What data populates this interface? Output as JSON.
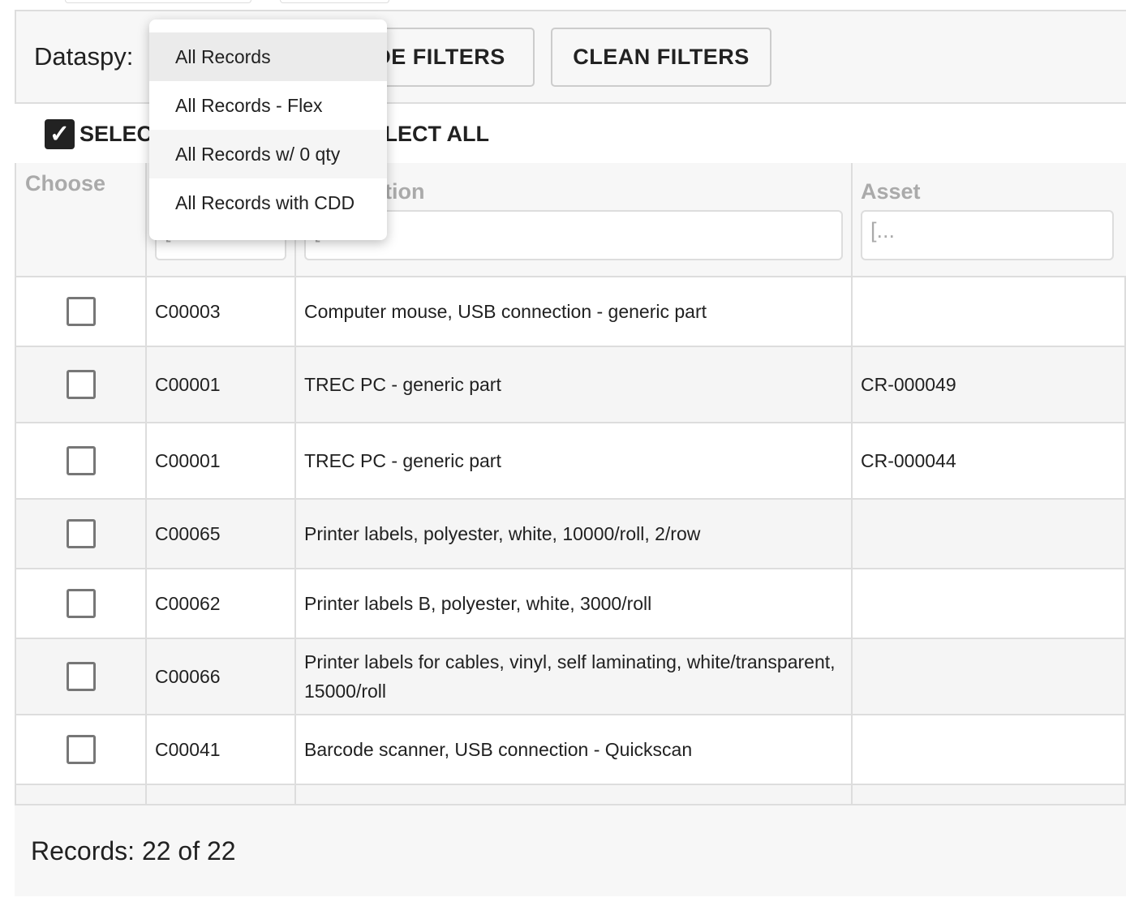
{
  "toolbar": {
    "dataspy_label": "Dataspy:",
    "hide_filters": "HIDE FILTERS",
    "clean_filters": "CLEAN FILTERS"
  },
  "selection": {
    "select_all": "SELECT ALL",
    "deselect_all": "DESELECT ALL",
    "select_all_checked": true
  },
  "table": {
    "headers": {
      "choose": "Choose",
      "description": "Description",
      "asset": "Asset"
    },
    "filter_placeholder": "[...",
    "rows": [
      {
        "code": "C00003",
        "description": "Computer mouse, USB connection - generic part",
        "asset": ""
      },
      {
        "code": "C00001",
        "description": "TREC PC - generic part",
        "asset": "CR-000049"
      },
      {
        "code": "C00001",
        "description": "TREC PC - generic part",
        "asset": "CR-000044"
      },
      {
        "code": "C00065",
        "description": "Printer labels, polyester, white, 10000/roll, 2/row",
        "asset": ""
      },
      {
        "code": "C00062",
        "description": "Printer labels B, polyester, white, 3000/roll",
        "asset": ""
      },
      {
        "code": "C00066",
        "description": "Printer labels for cables, vinyl, self laminating, white/transparent, 15000/roll",
        "asset": ""
      },
      {
        "code": "C00041",
        "description": "Barcode scanner, USB connection - Quickscan",
        "asset": ""
      }
    ]
  },
  "footer": {
    "records": "Records: 22 of 22"
  },
  "dataspy_dropdown": {
    "selected": "All Records",
    "options": [
      "All Records",
      "All Records - Flex",
      "All Records w/ 0 qty",
      "All Records with CDD"
    ]
  }
}
